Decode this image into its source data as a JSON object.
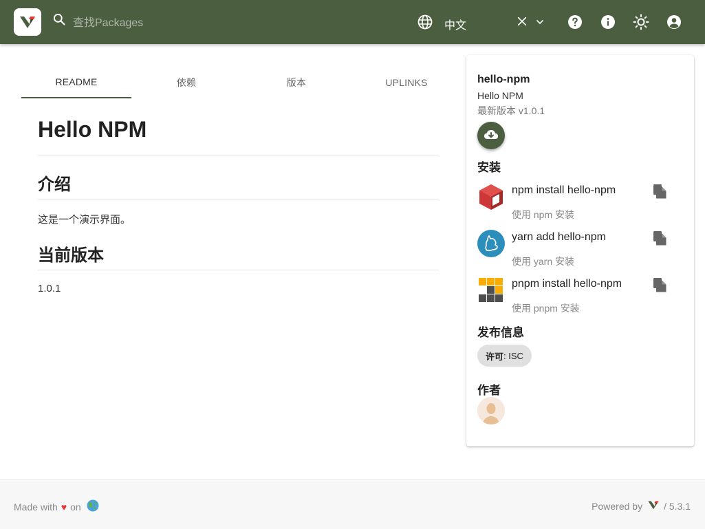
{
  "header": {
    "search_placeholder": "查找Packages",
    "language": "中文",
    "bg_color": "#4b5e40"
  },
  "tabs": [
    {
      "label": "README",
      "active": true
    },
    {
      "label": "依赖",
      "active": false
    },
    {
      "label": "版本",
      "active": false
    },
    {
      "label": "UPLINKS",
      "active": false
    }
  ],
  "readme": {
    "title": "Hello NPM",
    "section1_heading": "介绍",
    "section1_text": "这是一个演示界面。",
    "section2_heading": "当前版本",
    "section2_text": "1.0.1"
  },
  "sidebar": {
    "package_name": "hello-npm",
    "description": "Hello NPM",
    "latest_version": "最新版本 v1.0.1",
    "install_title": "安装",
    "installers": [
      {
        "command": "npm install hello-npm",
        "subtitle": "使用 npm 安装",
        "icon": "npm-icon"
      },
      {
        "command": "yarn add hello-npm",
        "subtitle": "使用 yarn 安装",
        "icon": "yarn-icon"
      },
      {
        "command": "pnpm install hello-npm",
        "subtitle": "使用 pnpm 安装",
        "icon": "pnpm-icon"
      }
    ],
    "publish_title": "发布信息",
    "license_label": "许可",
    "license_value": ": ISC",
    "author_title": "作者"
  },
  "footer": {
    "made_with": "Made with",
    "on": "on",
    "powered_by": "Powered by",
    "version": "/ 5.3.1"
  }
}
